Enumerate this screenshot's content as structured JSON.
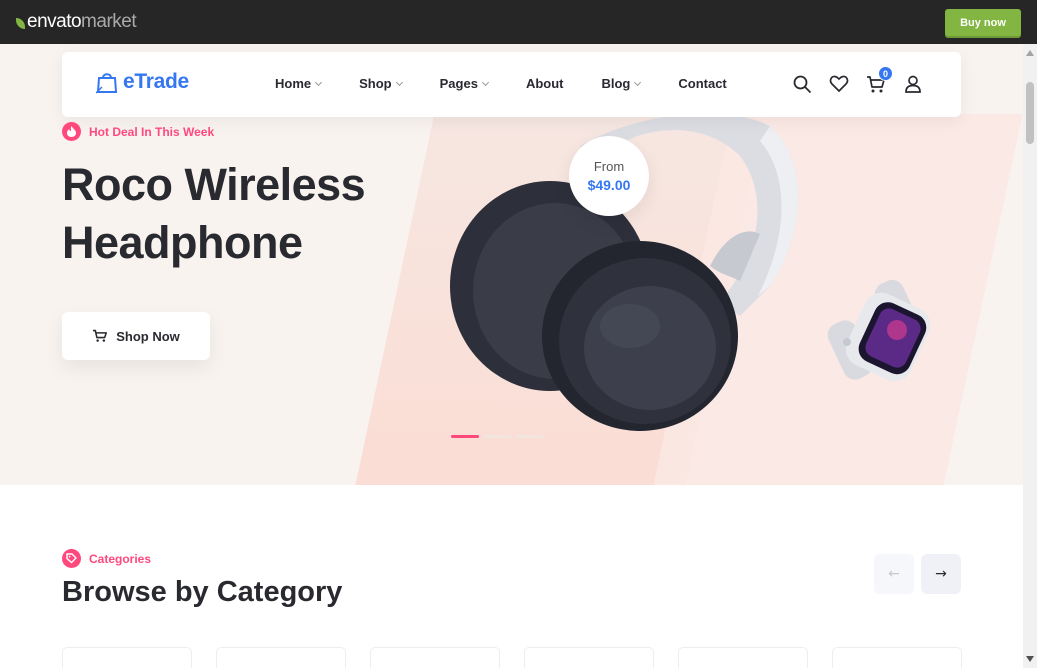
{
  "envato_bar": {
    "brand": "envato",
    "market": "market",
    "buy_now": "Buy now"
  },
  "header": {
    "logo_text": "eTrade",
    "nav": [
      {
        "label": "Home",
        "has_dropdown": true
      },
      {
        "label": "Shop",
        "has_dropdown": true
      },
      {
        "label": "Pages",
        "has_dropdown": true
      },
      {
        "label": "About",
        "has_dropdown": false
      },
      {
        "label": "Blog",
        "has_dropdown": true
      },
      {
        "label": "Contact",
        "has_dropdown": false
      }
    ],
    "icons": [
      "search-icon",
      "heart-icon",
      "cart-icon",
      "user-icon"
    ],
    "cart_count": "0"
  },
  "hero": {
    "tagline": "Hot Deal In This Week",
    "title_line1": "Roco Wireless",
    "title_line2": "Headphone",
    "shop_now": "Shop Now",
    "price_from": "From",
    "price": "$49.00",
    "slider_dots": 3,
    "active_dot": 0
  },
  "categories": {
    "subtitle": "Categories",
    "title": "Browse by Category",
    "prev_arrow": "←",
    "next_arrow": "→",
    "card_count": 6
  },
  "colors": {
    "accent": "#3577f0",
    "pink": "#ff497c",
    "envato_green": "#82b541",
    "text_dark": "#292930"
  }
}
